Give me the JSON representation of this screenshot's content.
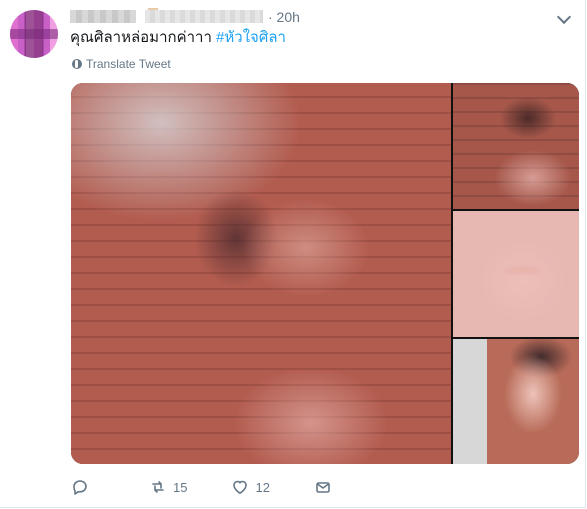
{
  "tweet": {
    "time_label": "· 20h",
    "text_main": "คุณศิลาหล่อมากค่าาา ",
    "hashtag": "#หัวใจศิลา",
    "translate_label": "Translate Tweet"
  },
  "actions": {
    "replies": "",
    "retweets": "15",
    "likes": "12"
  },
  "colors": {
    "accent": "#1da1f2",
    "muted": "#657786"
  }
}
